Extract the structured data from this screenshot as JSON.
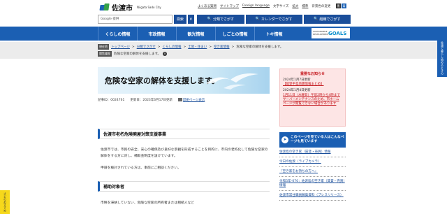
{
  "header": {
    "logo_text": "佐渡市",
    "logo_sub": "Niigata Sado City",
    "top_links": [
      "よくある質問",
      "サイトマップ",
      "Foreign language",
      "文字サイズ",
      "拡大",
      "標準",
      "背景色の変更"
    ],
    "color_options": [
      "黒",
      "青"
    ]
  },
  "search": {
    "placeholder": "Google 提供",
    "button_label": "検索",
    "chevron": "∨",
    "buttons": [
      "分類でさがす",
      "カレンダーでさがす",
      "組織でさがす"
    ]
  },
  "nav": {
    "items": [
      "くらしの情報",
      "市政情報",
      "観光情報",
      "しごとの情報",
      "トキ情報"
    ],
    "sdgs_sub": "SUSTAINABLE DEVELOPMENT",
    "sdgs_main": "GOALS"
  },
  "breadcrumb": {
    "badge": "現在地",
    "path": [
      "トップページ",
      "分類でさがす",
      "くらしの情報",
      "土地・住まい",
      "空き家情報"
    ],
    "current": "危険な空家の解体を支援します。",
    "history_badge": "閲覧履歴",
    "history_item": "危険な空家の解体を支援します。",
    "history_close": "×"
  },
  "page": {
    "title": "危険な空家の解体を支援します。",
    "article_id": "記事ID：0024761",
    "updated": "更新日：2023年6月17日更新",
    "print_label": "印刷ページ表示"
  },
  "sections": [
    {
      "heading": "佐渡市老朽危険廃屋対策支援事業",
      "paragraphs": [
        "佐渡市では、市民の安全、安心の確保及び良好な景観を形成することを目的に、市内の老朽化して危険な空家の解体をする方に対し、補助金制度を設けています。",
        "申請を検討されている方は、事前にご相談ください。"
      ]
    },
    {
      "heading": "補助対象者",
      "paragraphs": [
        "市税を滞納していない、危険な空家の所有者または相続人など"
      ]
    }
  ],
  "sidebar": {
    "notice_title": "重要なお知らせ",
    "notice_items": [
      {
        "date": "2024年1月7日更新",
        "link": "【能登半島地震情報まとめ】"
      },
      {
        "date": "2024年1月4日更新",
        "link": "1月11日（木曜日）午前2時から4時までサーバーメンテナンスのため、市ホームページが閲覧できない場合があります"
      }
    ],
    "related_title": "このページを見ている人はこんなページも見ています",
    "related_links": [
      "佐渡島の空き家（賃貸・売買）情報",
      "今日の佐渡（ライブカメラ）",
      "『空き家をお持ちの方へ』",
      "令和5年-070：佐渡島の空き家（賃貸・売買）情報",
      "佐渡市常住職員募集資料（プレスリリース）"
    ]
  },
  "side_tabs": {
    "right": "佐渡で暮らし始めるときの",
    "left": "さどのおすすめ"
  }
}
